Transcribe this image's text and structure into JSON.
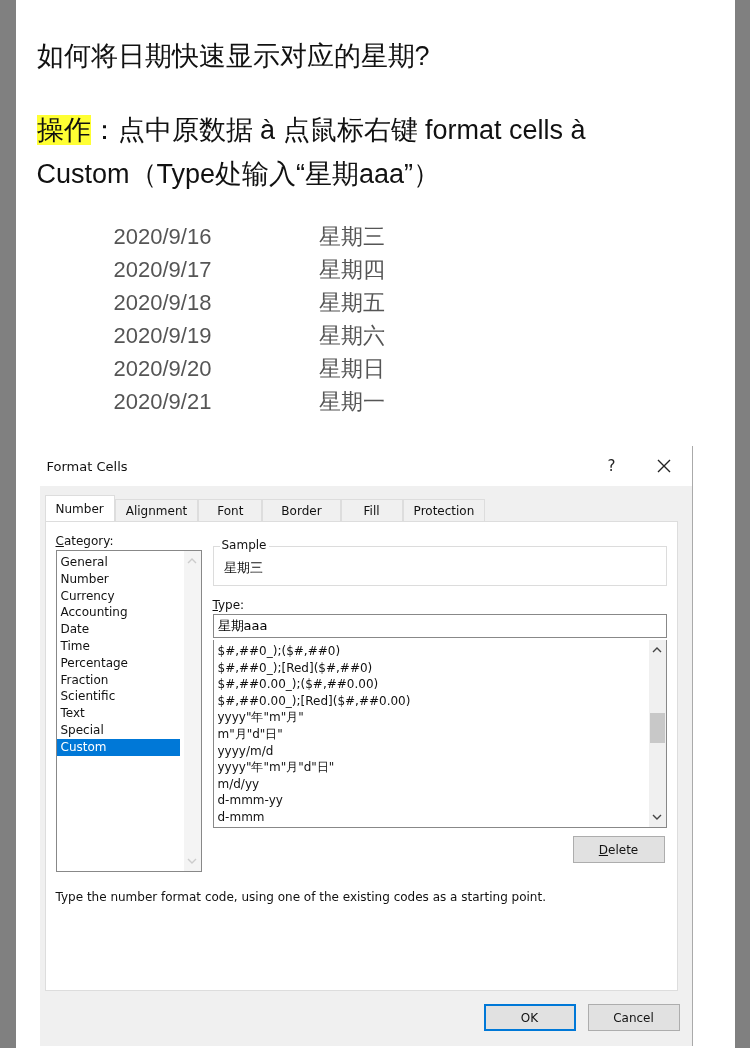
{
  "heading": "如何将日期快速显示对应的星期?",
  "instruction": [
    {
      "text": "操作",
      "highlighted": true
    },
    {
      "text": "：点中原数据 à 点鼠标右键 format cells à Custom（Type处输入“星期aaa”）",
      "highlighted": false
    }
  ],
  "examples": [
    {
      "date": "2020/9/16",
      "weekday": "星期三"
    },
    {
      "date": "2020/9/17",
      "weekday": "星期四"
    },
    {
      "date": "2020/9/18",
      "weekday": "星期五"
    },
    {
      "date": "2020/9/19",
      "weekday": "星期六"
    },
    {
      "date": "2020/9/20",
      "weekday": "星期日"
    },
    {
      "date": "2020/9/21",
      "weekday": "星期一"
    }
  ],
  "dialog": {
    "title": "Format Cells",
    "help": "?",
    "tabs": [
      {
        "label": "Number",
        "selected": true
      },
      {
        "label": "Alignment",
        "selected": false
      },
      {
        "label": "Font",
        "selected": false
      },
      {
        "label": "Border",
        "selected": false
      },
      {
        "label": "Fill",
        "selected": false
      },
      {
        "label": "Protection",
        "selected": false
      }
    ],
    "category_label": "Category:",
    "categories": [
      {
        "label": "General",
        "selected": false
      },
      {
        "label": "Number",
        "selected": false
      },
      {
        "label": "Currency",
        "selected": false
      },
      {
        "label": "Accounting",
        "selected": false
      },
      {
        "label": "Date",
        "selected": false
      },
      {
        "label": "Time",
        "selected": false
      },
      {
        "label": "Percentage",
        "selected": false
      },
      {
        "label": "Fraction",
        "selected": false
      },
      {
        "label": "Scientific",
        "selected": false
      },
      {
        "label": "Text",
        "selected": false
      },
      {
        "label": "Special",
        "selected": false
      },
      {
        "label": "Custom",
        "selected": true
      }
    ],
    "sample_label": "Sample",
    "sample_value": "星期三",
    "type_label": "Type:",
    "type_value": "星期aaa",
    "formats": [
      "$#,##0_);($#,##0)",
      "$#,##0_);[Red]($#,##0)",
      "$#,##0.00_);($#,##0.00)",
      "$#,##0.00_);[Red]($#,##0.00)",
      "yyyy\"年\"m\"月\"",
      "m\"月\"d\"日\"",
      "yyyy/m/d",
      "yyyy\"年\"m\"月\"d\"日\"",
      "m/d/yy",
      "d-mmm-yy",
      "d-mmm"
    ],
    "delete_button": "Delete",
    "description": "Type the number format code, using one of the existing codes as a starting point.",
    "ok_button": "OK",
    "cancel_button": "Cancel"
  }
}
